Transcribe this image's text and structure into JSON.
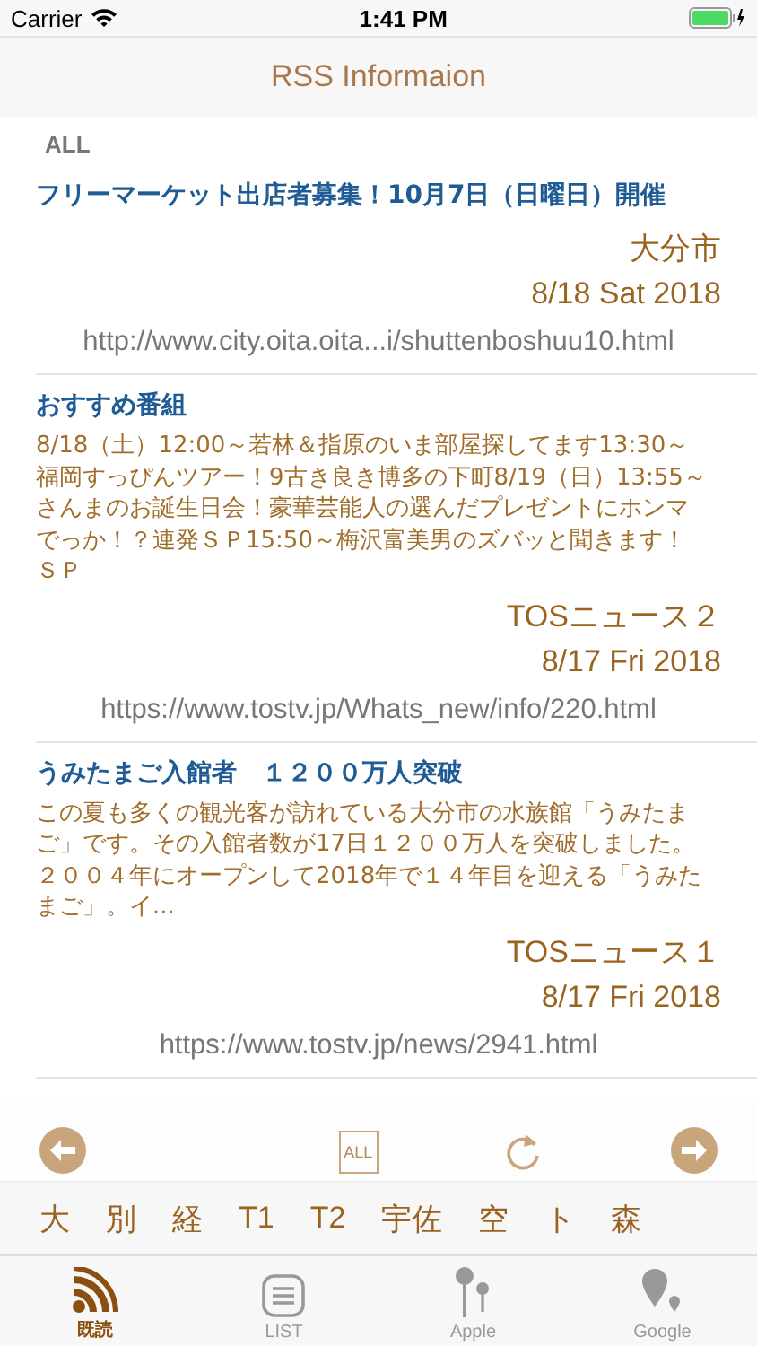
{
  "status_bar": {
    "carrier": "Carrier",
    "time": "1:41 PM"
  },
  "nav": {
    "title": "RSS Informaion"
  },
  "section": "ALL",
  "articles": [
    {
      "title": "フリーマーケット出店者募集！10月7日（日曜日）開催",
      "source": "大分市",
      "date": "8/18 Sat 2018",
      "url": "http://www.city.oita.oita...i/shuttenboshuu10.html"
    },
    {
      "title": "おすすめ番組",
      "description": "8/18（土）12:00～若林＆指原のいま部屋探してます13:30～福岡すっぴんツアー！9古き良き博多の下町8/19（日）13:55～さんまのお誕生日会！豪華芸能人の選んだプレゼントにホンマでっか！？連発ＳＰ15:50～梅沢富美男のズバッと聞きます！ＳＰ",
      "source": "TOSニュース２",
      "date": "8/17 Fri 2018",
      "url": "https://www.tostv.jp/Whats_new/info/220.html"
    },
    {
      "title": "うみたまご入館者　１２００万人突破",
      "description": "この夏も多くの観光客が訪れている大分市の水族館「うみたまご」です。その入館者数が17日１２００万人を突破しました。２００４年にオープンして2018年で１４年目を迎える「うみたまご」。イ...",
      "source": "TOSニュース１",
      "date": "8/17 Fri 2018",
      "url": "https://www.tostv.jp/news/2941.html"
    }
  ],
  "toolbar": {
    "filter_label": "ALL"
  },
  "categories": [
    "大",
    "別",
    "経",
    "T1",
    "T2",
    "宇佐",
    "空",
    "ト",
    "森"
  ],
  "tabs": [
    {
      "label": "既読",
      "kind": "rss",
      "selected": true
    },
    {
      "label": "LIST",
      "kind": "list",
      "selected": false
    },
    {
      "label": "Apple",
      "kind": "pins",
      "selected": false
    },
    {
      "label": "Google",
      "kind": "pin",
      "selected": false
    }
  ]
}
